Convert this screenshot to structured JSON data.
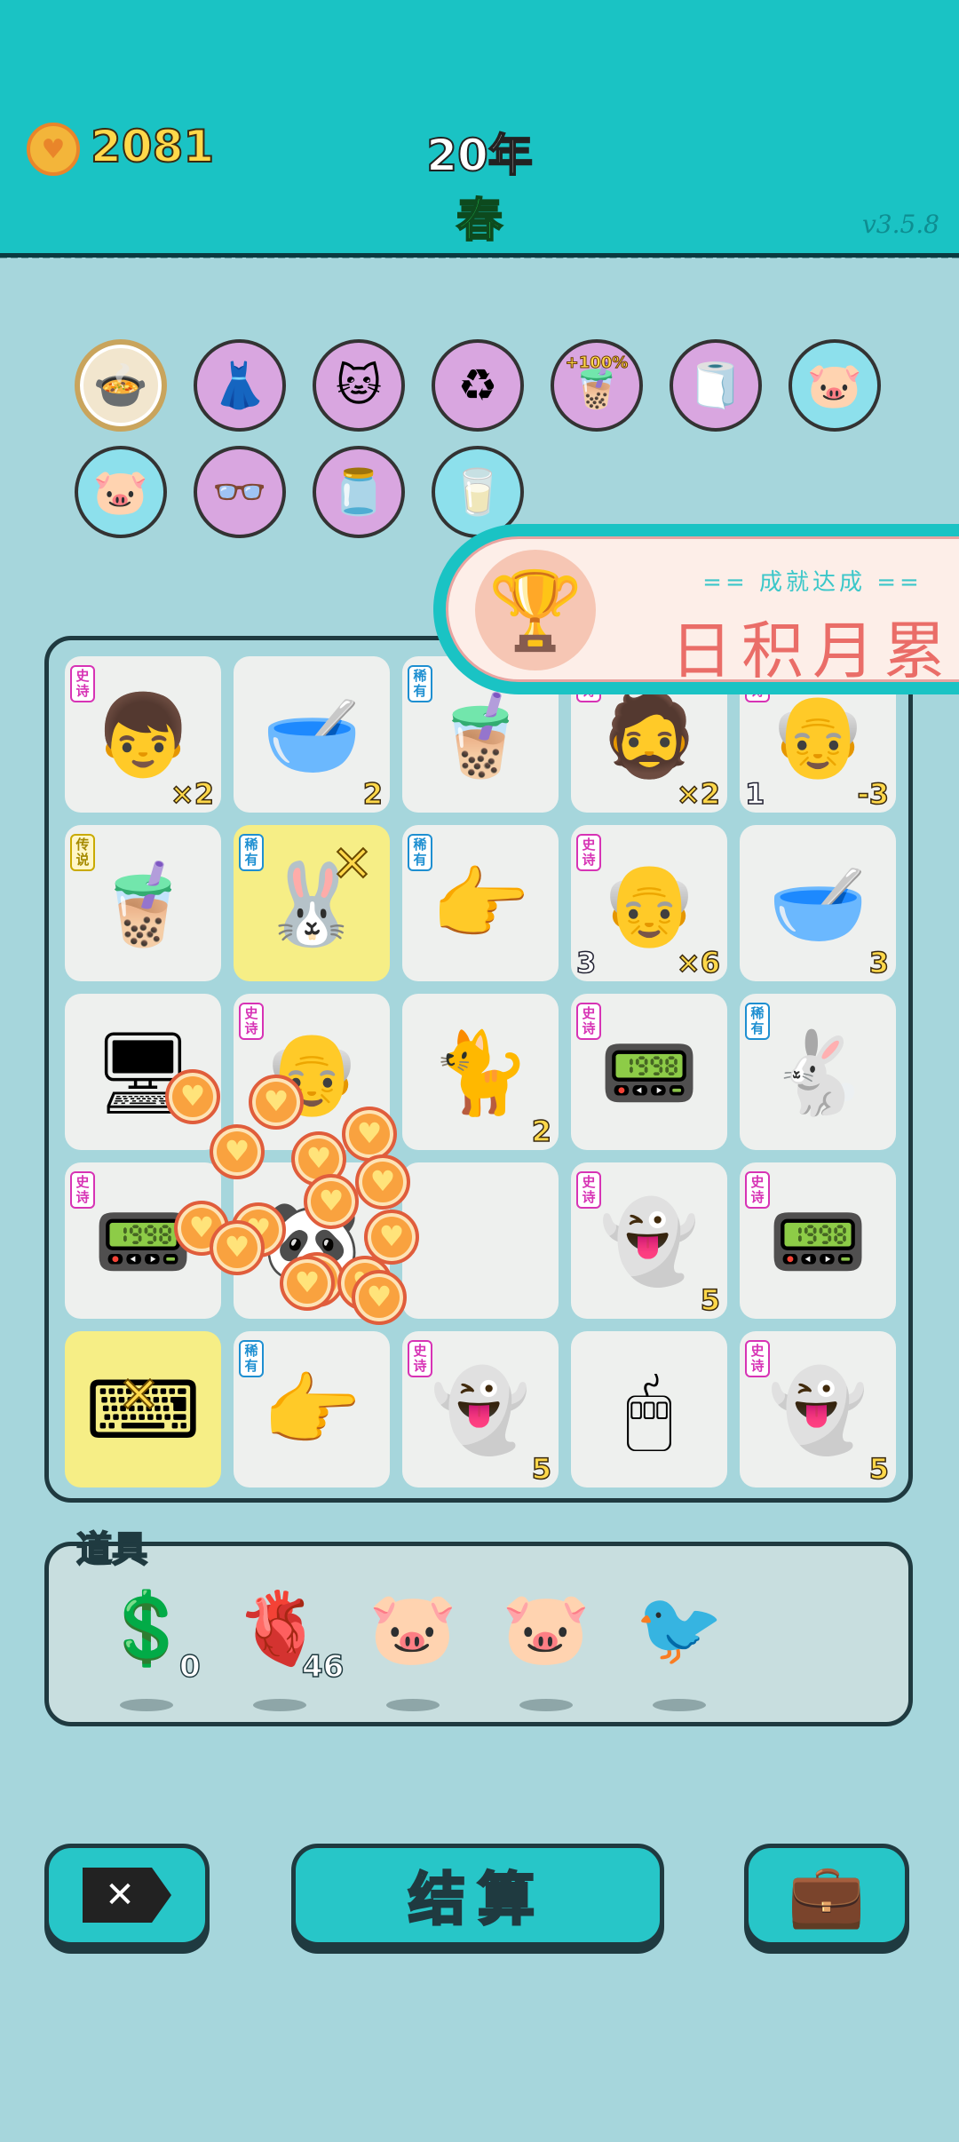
{
  "header": {
    "coins": "2081",
    "year": "20年",
    "season": "春",
    "version": "v3.5.8"
  },
  "relics": [
    {
      "name": "rice-cooker-duck-icon",
      "glyph": "🍲"
    },
    {
      "name": "pleated-skirt-icon",
      "glyph": "👗"
    },
    {
      "name": "cat-coin-icon",
      "glyph": "🐱"
    },
    {
      "name": "recycle-icon",
      "glyph": "♻"
    },
    {
      "name": "milk-tea-boost-icon",
      "glyph": "🧋",
      "label": "+100%"
    },
    {
      "name": "tissue-box-icon",
      "glyph": "🧻"
    },
    {
      "name": "piggy-bank-icon",
      "glyph": "🐷"
    },
    {
      "name": "piggy-bank-icon",
      "glyph": "🐷"
    },
    {
      "name": "multiplier-man-icon",
      "glyph": "👓"
    },
    {
      "name": "jar-icon",
      "glyph": "🫙"
    },
    {
      "name": "gravy-boat-icon",
      "glyph": "🥛"
    }
  ],
  "achievement": {
    "subtitle": "== 成就达成 ==",
    "title": "日积月累"
  },
  "tags": {
    "epic": "史诗",
    "rare": "稀有",
    "legend": "传说"
  },
  "board": [
    [
      {
        "tag": "epic",
        "glyph": "👦",
        "right": "×2"
      },
      {
        "glyph": "🥣",
        "right": "2"
      },
      {
        "tag": "rare",
        "glyph": "🧋"
      },
      {
        "tag": "epic",
        "glyph": "🧔",
        "right": "×2"
      },
      {
        "tag": "epic",
        "glyph": "👴",
        "left": "1",
        "right": "-3"
      }
    ],
    [
      {
        "tag": "legend",
        "glyph": "🧋"
      },
      {
        "tag": "rare",
        "glyph": "🐰",
        "yellow": true
      },
      {
        "tag": "rare",
        "glyph": "👉"
      },
      {
        "tag": "epic",
        "glyph": "👴",
        "left": "3",
        "right": "×6"
      },
      {
        "glyph": "🥣",
        "right": "3"
      }
    ],
    [
      {
        "glyph": "🖥"
      },
      {
        "tag": "epic",
        "glyph": "👴"
      },
      {
        "glyph": "🐈",
        "right": "2"
      },
      {
        "tag": "epic",
        "glyph": "📟"
      },
      {
        "tag": "rare",
        "glyph": "🐇"
      }
    ],
    [
      {
        "tag": "epic",
        "glyph": "📟"
      },
      {
        "glyph": "🐼"
      },
      {
        "glyph": ""
      },
      {
        "tag": "epic",
        "glyph": "👻",
        "right": "5"
      },
      {
        "tag": "epic",
        "glyph": "📟"
      }
    ],
    [
      {
        "glyph": "⌨",
        "yellow": true
      },
      {
        "tag": "rare",
        "glyph": "👉"
      },
      {
        "tag": "epic",
        "glyph": "👻",
        "right": "5"
      },
      {
        "glyph": "🖱"
      },
      {
        "tag": "epic",
        "glyph": "👻",
        "right": "5"
      }
    ]
  ],
  "items": {
    "label": "道具",
    "list": [
      {
        "name": "dollar-coin-icon",
        "glyph": "💲",
        "count": "0"
      },
      {
        "name": "liver-icon",
        "glyph": "🫀",
        "count": "46"
      },
      {
        "name": "piggy-bank-icon",
        "glyph": "🐷",
        "count": ""
      },
      {
        "name": "piggy-bank-icon",
        "glyph": "🐷",
        "count": ""
      },
      {
        "name": "bird-icon",
        "glyph": "🐦",
        "count": ""
      }
    ]
  },
  "buttons": {
    "close": "✕",
    "settle": "结算",
    "bag": "💼"
  }
}
